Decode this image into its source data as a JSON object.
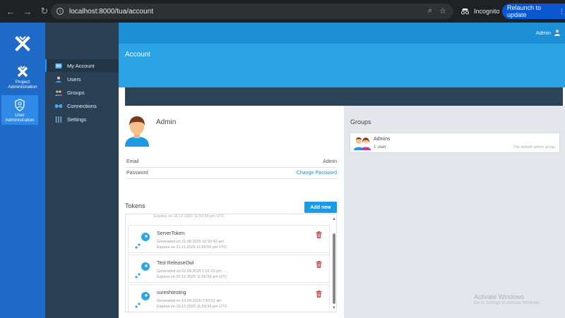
{
  "browser": {
    "url": "localhost:8000/tua/account",
    "incognito_label": "Incognito",
    "relaunch_label": "Relaunch to update",
    "menu_glyph": "⋮"
  },
  "app_rail": {
    "items": [
      {
        "label_line1": "Project",
        "label_line2": "Administration",
        "icon": "logo-x-icon"
      },
      {
        "label_line1": "User",
        "label_line2": "Administration",
        "icon": "user-shield-icon"
      }
    ]
  },
  "side_nav": {
    "items": [
      {
        "label": "My Account",
        "icon": "account-card-icon"
      },
      {
        "label": "Users",
        "icon": "user-icon"
      },
      {
        "label": "Groups",
        "icon": "group-icon"
      },
      {
        "label": "Connections",
        "icon": "connections-icon"
      },
      {
        "label": "Settings",
        "icon": "settings-bars-icon"
      }
    ]
  },
  "topbar": {
    "user_label": "Admin"
  },
  "page": {
    "title": "Account"
  },
  "account": {
    "name": "Admin",
    "email_label": "Email",
    "email_value": "Admin",
    "password_label": "Password",
    "change_password_label": "Change Password"
  },
  "tokens": {
    "title": "Tokens",
    "add_label": "Add new",
    "partial_row_text": "Expires on 10.12.2025 11:59:59 pm UTC",
    "items": [
      {
        "name": "ServerToken",
        "generated": "Generated on 21.08.2025 10:32:40 am",
        "expires": "Expires on 21.11.2025 11:59:59 pm UTC"
      },
      {
        "name": "Test ReleaseOwl",
        "generated": "Generated on 02.09.2025 1:01:23 pm",
        "expires": "Expires on 02.12.2025 11:59:59 pm UTC"
      },
      {
        "name": "sureshtesting",
        "generated": "Generated on 10.09.2025 7:43:51 am",
        "expires": "Expires on 10.12.2025 11:59:59 pm UTC"
      }
    ]
  },
  "groups": {
    "title": "Groups",
    "items": [
      {
        "name": "Admins",
        "count": "1 user",
        "description": "The default admin group"
      }
    ]
  },
  "watermark": {
    "title": "Activate Windows",
    "subtitle": "Go to Settings to activate Windows."
  },
  "colors": {
    "rail": "#1f69c7",
    "sidenav": "#2a4055",
    "accent": "#2ba3e4",
    "button": "#1a9be6"
  }
}
